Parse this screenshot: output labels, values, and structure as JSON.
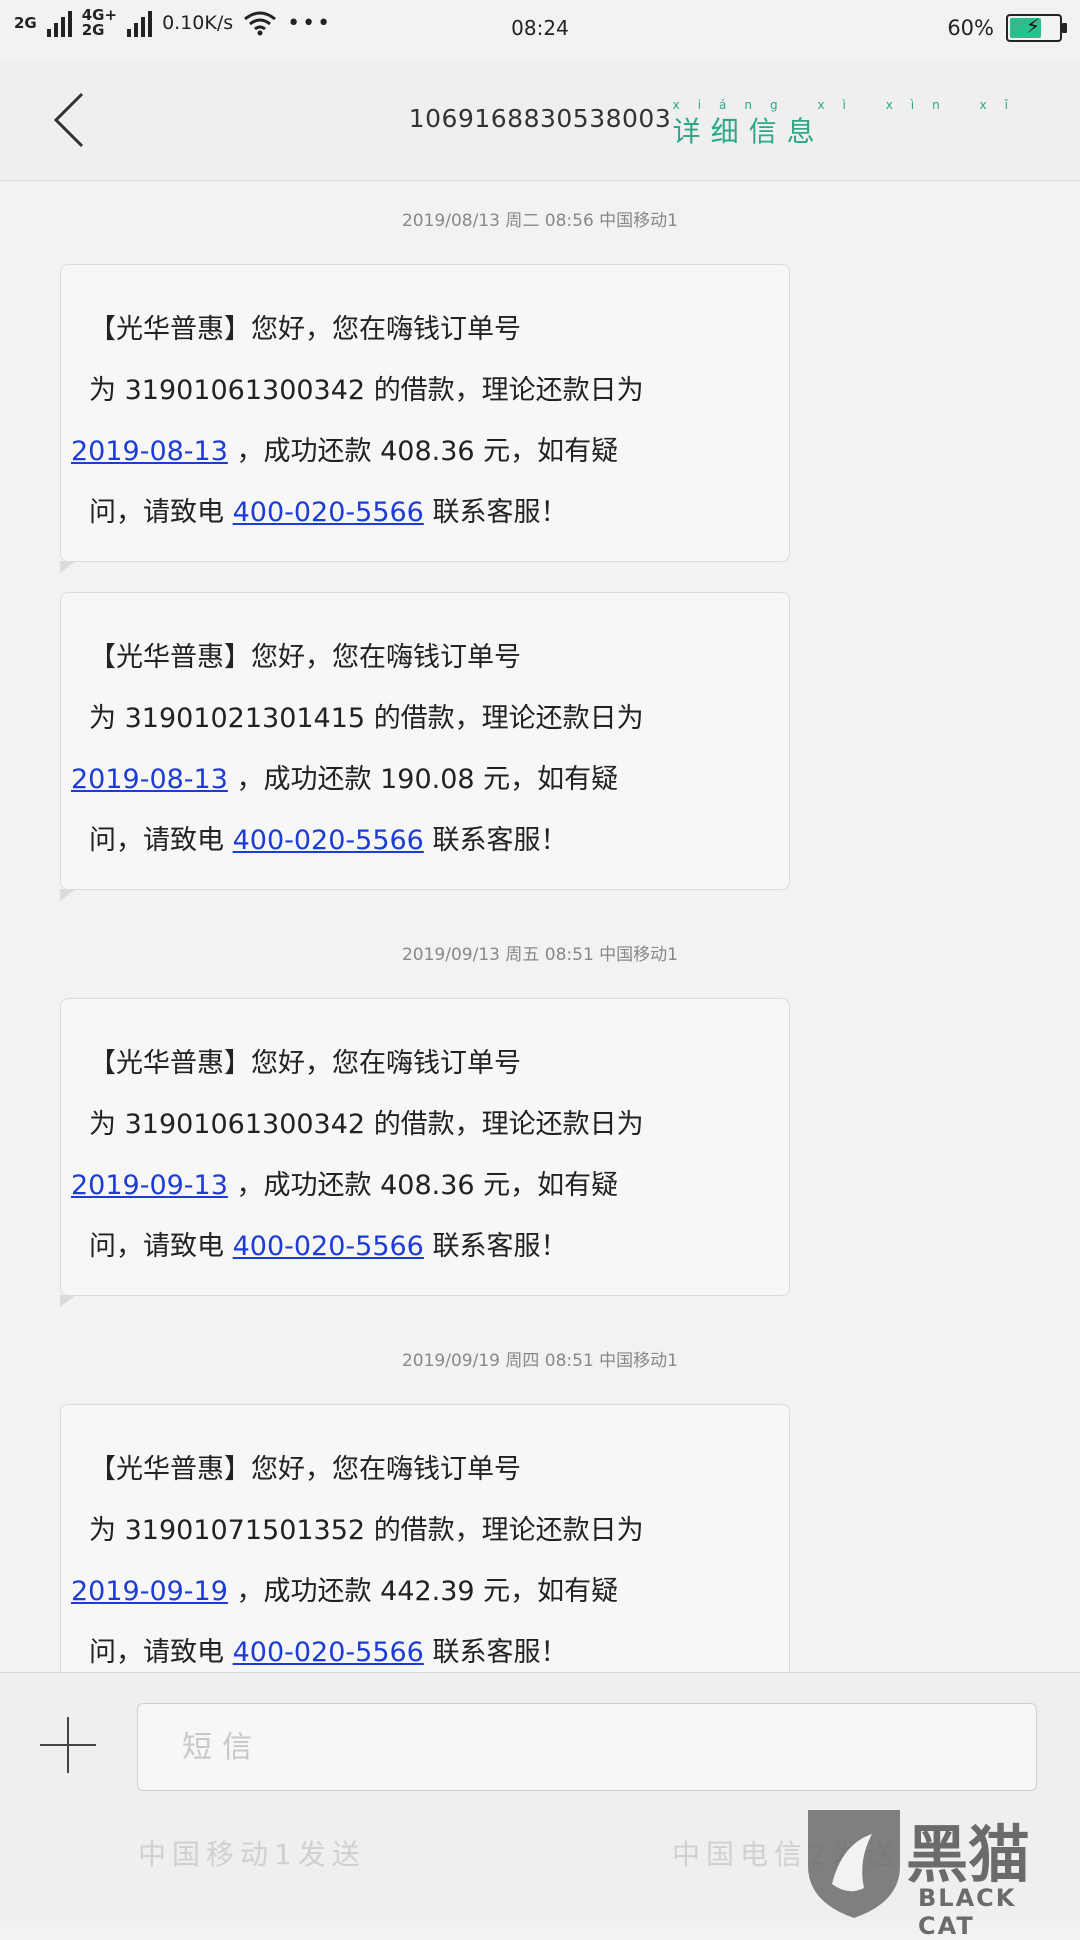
{
  "status_bar": {
    "net1": "2G",
    "net2a": "4G+",
    "net2b": "2G",
    "speed": "0.10K/s",
    "more": "•••",
    "time": "08:24",
    "battery": "60%"
  },
  "header": {
    "title": "1069168830538003",
    "details": "详细信息",
    "details_pinyin": "xiáng xì xìn xī"
  },
  "timestamps": [
    "2019/08/13 周二 08:56 中国移动1",
    "2019/09/13 周五 08:51 中国移动1",
    "2019/09/19 周四 08:51 中国移动1"
  ],
  "messages": [
    {
      "l1": "【光华普惠】您好，您在嗨钱订单号",
      "p1": "为",
      "order": "31901061300342",
      "p2": "的借款，理论还款日为",
      "date": "2019-08-13",
      "p3": "，成功还款 408.36 元，如有疑",
      "p4": "问，请致电",
      "phone": "400-020-5566",
      "p5": "联系客服！"
    },
    {
      "l1": "【光华普惠】您好，您在嗨钱订单号",
      "p1": "为",
      "order": "31901021301415",
      "p2": "的借款，理论还款日为",
      "date": "2019-08-13",
      "p3": "，成功还款 190.08 元，如有疑",
      "p4": "问，请致电",
      "phone": "400-020-5566",
      "p5": "联系客服！"
    },
    {
      "l1": "【光华普惠】您好，您在嗨钱订单号",
      "p1": "为",
      "order": "31901061300342",
      "p2": "的借款，理论还款日为",
      "date": "2019-09-13",
      "p3": "，成功还款 408.36 元，如有疑",
      "p4": "问，请致电",
      "phone": "400-020-5566",
      "p5": "联系客服！"
    },
    {
      "l1": "【光华普惠】您好，您在嗨钱订单号",
      "p1": "为",
      "order": "31901071501352",
      "p2": "的借款，理论还款日为",
      "date": "2019-09-19",
      "p3": "，成功还款 442.39 元，如有疑",
      "p4": "问，请致电",
      "phone": "400-020-5566",
      "p5": "联系客服！"
    }
  ],
  "input": {
    "placeholder": "短信",
    "send_left": "中国移动1发送",
    "send_right": "中国电信2发送"
  },
  "watermark": {
    "cn": "黑猫",
    "en": "BLACK CAT"
  }
}
